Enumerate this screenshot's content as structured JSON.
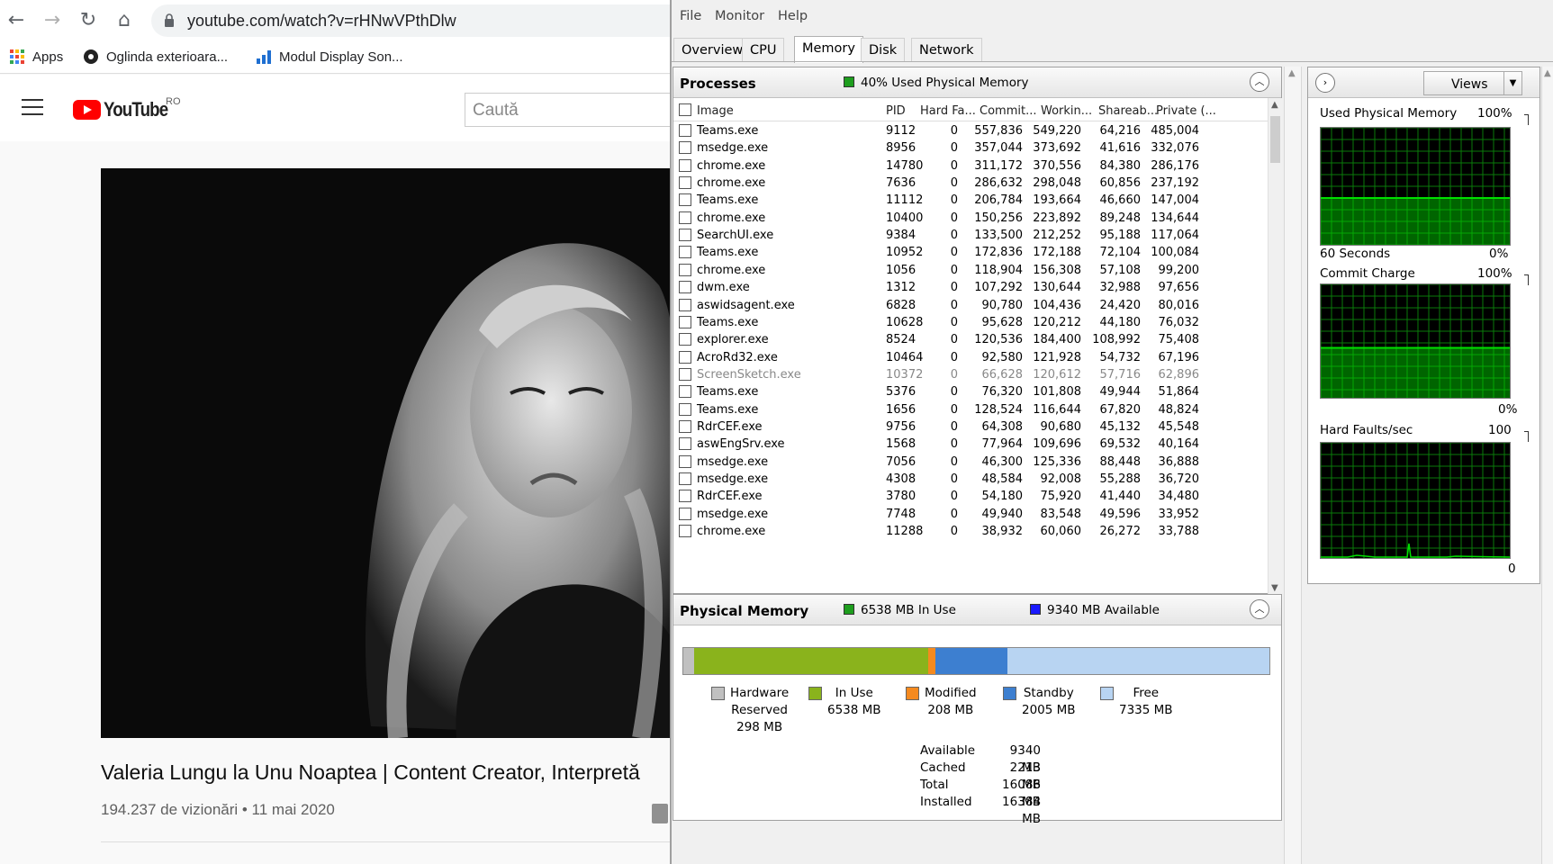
{
  "browser": {
    "url": "youtube.com/watch?v=rHNwVPthDlw",
    "bookmarks": [
      "Apps",
      "Oglinda exterioara...",
      "Modul Display Son..."
    ],
    "youtube": {
      "logo_text": "YouTube",
      "country": "RO",
      "search_placeholder": "Caută",
      "video_title": "Valeria Lungu la Unu Noaptea | Content Creator, Interpretă",
      "video_meta": "194.237 de vizionări • 11 mai 2020"
    }
  },
  "resmon": {
    "menu": [
      "File",
      "Monitor",
      "Help"
    ],
    "tabs": [
      "Overview",
      "CPU",
      "Memory",
      "Disk",
      "Network"
    ],
    "active_tab": "Memory",
    "processes": {
      "title": "Processes",
      "stat": "40% Used Physical Memory",
      "stat_color": "#1e9e1e",
      "columns": [
        "Image",
        "PID",
        "Hard Fa...",
        "Commit...",
        "Workin...",
        "Shareab...",
        "Private (..."
      ],
      "rows": [
        {
          "image": "Teams.exe",
          "pid": "9112",
          "hf": "0",
          "commit": "557,836",
          "working": "549,220",
          "share": "64,216",
          "private": "485,004",
          "dim": false
        },
        {
          "image": "msedge.exe",
          "pid": "8956",
          "hf": "0",
          "commit": "357,044",
          "working": "373,692",
          "share": "41,616",
          "private": "332,076",
          "dim": false
        },
        {
          "image": "chrome.exe",
          "pid": "14780",
          "hf": "0",
          "commit": "311,172",
          "working": "370,556",
          "share": "84,380",
          "private": "286,176",
          "dim": false
        },
        {
          "image": "chrome.exe",
          "pid": "7636",
          "hf": "0",
          "commit": "286,632",
          "working": "298,048",
          "share": "60,856",
          "private": "237,192",
          "dim": false
        },
        {
          "image": "Teams.exe",
          "pid": "11112",
          "hf": "0",
          "commit": "206,784",
          "working": "193,664",
          "share": "46,660",
          "private": "147,004",
          "dim": false
        },
        {
          "image": "chrome.exe",
          "pid": "10400",
          "hf": "0",
          "commit": "150,256",
          "working": "223,892",
          "share": "89,248",
          "private": "134,644",
          "dim": false
        },
        {
          "image": "SearchUI.exe",
          "pid": "9384",
          "hf": "0",
          "commit": "133,500",
          "working": "212,252",
          "share": "95,188",
          "private": "117,064",
          "dim": false
        },
        {
          "image": "Teams.exe",
          "pid": "10952",
          "hf": "0",
          "commit": "172,836",
          "working": "172,188",
          "share": "72,104",
          "private": "100,084",
          "dim": false
        },
        {
          "image": "chrome.exe",
          "pid": "1056",
          "hf": "0",
          "commit": "118,904",
          "working": "156,308",
          "share": "57,108",
          "private": "99,200",
          "dim": false
        },
        {
          "image": "dwm.exe",
          "pid": "1312",
          "hf": "0",
          "commit": "107,292",
          "working": "130,644",
          "share": "32,988",
          "private": "97,656",
          "dim": false
        },
        {
          "image": "aswidsagent.exe",
          "pid": "6828",
          "hf": "0",
          "commit": "90,780",
          "working": "104,436",
          "share": "24,420",
          "private": "80,016",
          "dim": false
        },
        {
          "image": "Teams.exe",
          "pid": "10628",
          "hf": "0",
          "commit": "95,628",
          "working": "120,212",
          "share": "44,180",
          "private": "76,032",
          "dim": false
        },
        {
          "image": "explorer.exe",
          "pid": "8524",
          "hf": "0",
          "commit": "120,536",
          "working": "184,400",
          "share": "108,992",
          "private": "75,408",
          "dim": false
        },
        {
          "image": "AcroRd32.exe",
          "pid": "10464",
          "hf": "0",
          "commit": "92,580",
          "working": "121,928",
          "share": "54,732",
          "private": "67,196",
          "dim": false
        },
        {
          "image": "ScreenSketch.exe",
          "pid": "10372",
          "hf": "0",
          "commit": "66,628",
          "working": "120,612",
          "share": "57,716",
          "private": "62,896",
          "dim": true
        },
        {
          "image": "Teams.exe",
          "pid": "5376",
          "hf": "0",
          "commit": "76,320",
          "working": "101,808",
          "share": "49,944",
          "private": "51,864",
          "dim": false
        },
        {
          "image": "Teams.exe",
          "pid": "1656",
          "hf": "0",
          "commit": "128,524",
          "working": "116,644",
          "share": "67,820",
          "private": "48,824",
          "dim": false
        },
        {
          "image": "RdrCEF.exe",
          "pid": "9756",
          "hf": "0",
          "commit": "64,308",
          "working": "90,680",
          "share": "45,132",
          "private": "45,548",
          "dim": false
        },
        {
          "image": "aswEngSrv.exe",
          "pid": "1568",
          "hf": "0",
          "commit": "77,964",
          "working": "109,696",
          "share": "69,532",
          "private": "40,164",
          "dim": false
        },
        {
          "image": "msedge.exe",
          "pid": "7056",
          "hf": "0",
          "commit": "46,300",
          "working": "125,336",
          "share": "88,448",
          "private": "36,888",
          "dim": false
        },
        {
          "image": "msedge.exe",
          "pid": "4308",
          "hf": "0",
          "commit": "48,584",
          "working": "92,008",
          "share": "55,288",
          "private": "36,720",
          "dim": false
        },
        {
          "image": "RdrCEF.exe",
          "pid": "3780",
          "hf": "0",
          "commit": "54,180",
          "working": "75,920",
          "share": "41,440",
          "private": "34,480",
          "dim": false
        },
        {
          "image": "msedge.exe",
          "pid": "7748",
          "hf": "0",
          "commit": "49,940",
          "working": "83,548",
          "share": "49,596",
          "private": "33,952",
          "dim": false
        },
        {
          "image": "chrome.exe",
          "pid": "11288",
          "hf": "0",
          "commit": "38,932",
          "working": "60,060",
          "share": "26,272",
          "private": "33,788",
          "dim": false
        }
      ]
    },
    "physical_memory": {
      "title": "Physical Memory",
      "in_use_stat": "6538 MB In Use",
      "available_stat": "9340 MB Available",
      "in_use_color": "#1e9e1e",
      "available_color": "#1a1aff",
      "segments": [
        {
          "name": "Hardware Reserved",
          "mb": 298,
          "color": "#c0c0c0"
        },
        {
          "name": "In Use",
          "mb": 6538,
          "color": "#8ab31c"
        },
        {
          "name": "Modified",
          "mb": 208,
          "color": "#f58a1f"
        },
        {
          "name": "Standby",
          "mb": 2005,
          "color": "#3d7fd0"
        },
        {
          "name": "Free",
          "mb": 7335,
          "color": "#b8d4f2"
        }
      ],
      "legend": [
        {
          "label": "Hardware\nReserved\n298 MB"
        },
        {
          "label": "In Use\n6538 MB"
        },
        {
          "label": "Modified\n208 MB"
        },
        {
          "label": "Standby\n2005 MB"
        },
        {
          "label": "Free\n7335 MB"
        }
      ],
      "stats": [
        {
          "k": "Available",
          "v": "9340 MB"
        },
        {
          "k": "Cached",
          "v": "2213 MB"
        },
        {
          "k": "Total",
          "v": "16086 MB"
        },
        {
          "k": "Installed",
          "v": "16384 MB"
        }
      ]
    },
    "graphs": {
      "views_label": "Views",
      "used_physical": {
        "title": "Used Physical Memory",
        "max": "100%",
        "min": "0%",
        "time": "60 Seconds",
        "level": 0.4
      },
      "commit_charge": {
        "title": "Commit Charge",
        "max": "100%",
        "min": "0%",
        "level": 0.44
      },
      "hard_faults": {
        "title": "Hard Faults/sec",
        "max": "100",
        "min": "0"
      },
      "line_color": "#00e000",
      "grid_color": "#0a7a0a"
    }
  }
}
